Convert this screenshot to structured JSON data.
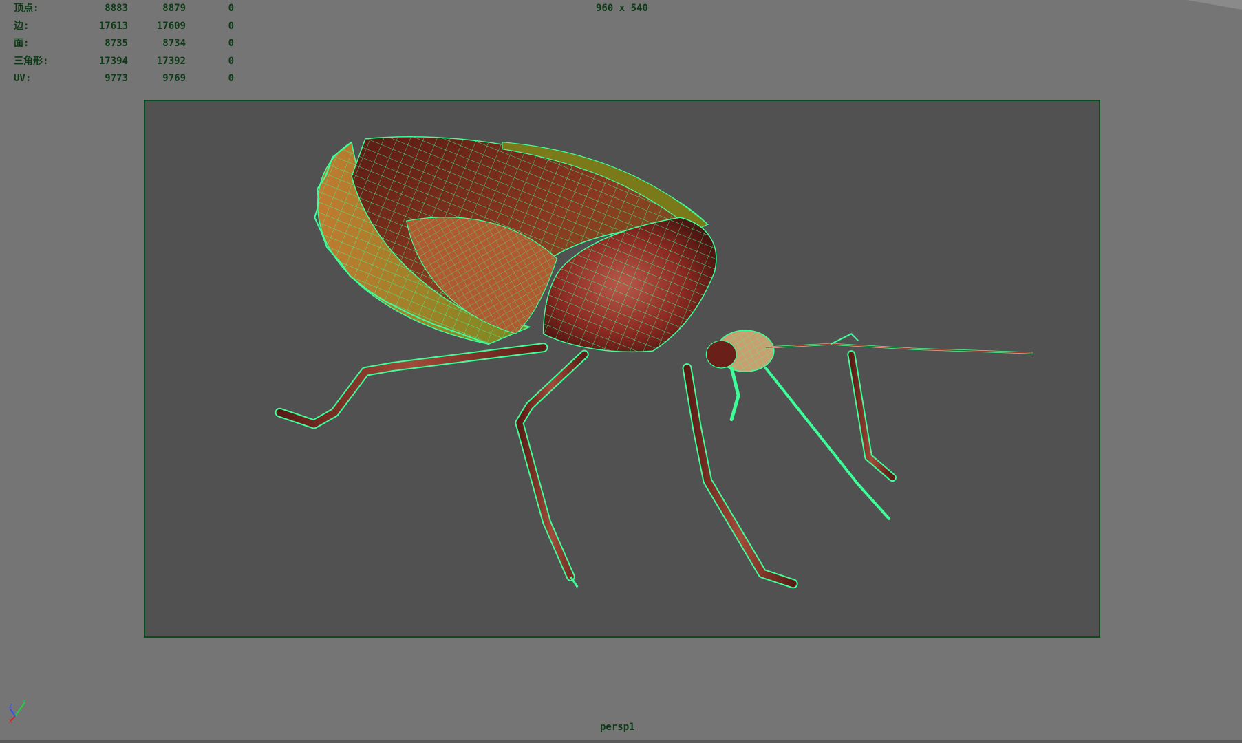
{
  "viewport": {
    "resolution": "960 x 540",
    "camera": "persp1",
    "background_color": "#757575",
    "gate_color": "#515151",
    "wire_color": "#3dff9a"
  },
  "poly_count": {
    "rows": [
      {
        "label": "顶点:",
        "v1": "8883",
        "v2": "8879",
        "v3": "0"
      },
      {
        "label": "边:",
        "v1": "17613",
        "v2": "17609",
        "v3": "0"
      },
      {
        "label": "面:",
        "v1": "8735",
        "v2": "8734",
        "v3": "0"
      },
      {
        "label": "三角形:",
        "v1": "17394",
        "v2": "17392",
        "v3": "0"
      },
      {
        "label": "UV:",
        "v1": "9773",
        "v2": "9769",
        "v3": "0"
      }
    ]
  },
  "axis": {
    "x_label": "X",
    "y_label": "Y",
    "z_label": "Z"
  }
}
